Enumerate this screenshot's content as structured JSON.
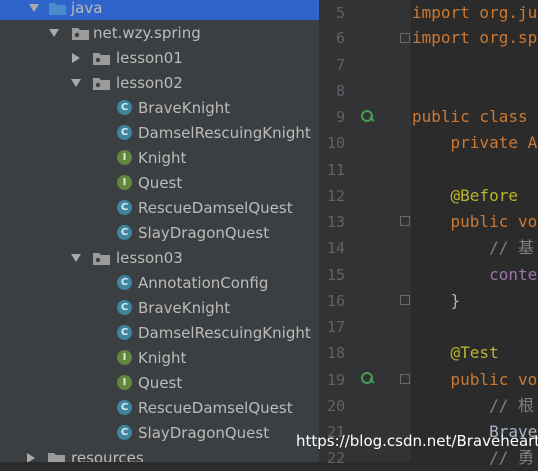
{
  "project_tree": {
    "rows": [
      {
        "label": "java",
        "kind": "folder-source",
        "expanded": true,
        "selected": true
      },
      {
        "label": "net.wzy.spring",
        "kind": "package",
        "expanded": true
      },
      {
        "label": "lesson01",
        "kind": "package",
        "expanded": false
      },
      {
        "label": "lesson02",
        "kind": "package",
        "expanded": true
      },
      {
        "label": "BraveKnight",
        "kind": "class"
      },
      {
        "label": "DamselRescuingKnight",
        "kind": "class"
      },
      {
        "label": "Knight",
        "kind": "interface"
      },
      {
        "label": "Quest",
        "kind": "interface"
      },
      {
        "label": "RescueDamselQuest",
        "kind": "class"
      },
      {
        "label": "SlayDragonQuest",
        "kind": "class"
      },
      {
        "label": "lesson03",
        "kind": "package",
        "expanded": true
      },
      {
        "label": "AnnotationConfig",
        "kind": "class"
      },
      {
        "label": "BraveKnight",
        "kind": "class"
      },
      {
        "label": "DamselRescuingKnight",
        "kind": "class"
      },
      {
        "label": "Knight",
        "kind": "interface"
      },
      {
        "label": "Quest",
        "kind": "interface"
      },
      {
        "label": "RescueDamselQuest",
        "kind": "class"
      },
      {
        "label": "SlayDragonQuest",
        "kind": "class"
      },
      {
        "label": "resources",
        "kind": "folder",
        "expanded": false
      }
    ],
    "class_glyph": "C",
    "interface_glyph": "I"
  },
  "editor": {
    "lines": [
      {
        "num": "5",
        "text": "import org.ju"
      },
      {
        "num": "6",
        "text": "import org.sp"
      },
      {
        "num": "7",
        "text": ""
      },
      {
        "num": "8",
        "text": ""
      },
      {
        "num": "9",
        "text": "public class "
      },
      {
        "num": "10",
        "text": "    private A"
      },
      {
        "num": "11",
        "text": ""
      },
      {
        "num": "12",
        "text": "    @Before"
      },
      {
        "num": "13",
        "text": "    public vo"
      },
      {
        "num": "14",
        "text": "        // 基"
      },
      {
        "num": "15",
        "text": "        conte"
      },
      {
        "num": "16",
        "text": "    }"
      },
      {
        "num": "17",
        "text": ""
      },
      {
        "num": "18",
        "text": "    @Test"
      },
      {
        "num": "19",
        "text": "    public vo"
      },
      {
        "num": "20",
        "text": "        // 根"
      },
      {
        "num": "21",
        "text": "        Brave"
      },
      {
        "num": "22",
        "text": "        // 勇"
      }
    ]
  },
  "watermark": "https://blog.csdn.net/Braveheart",
  "colors": {
    "tree_bg": "#3c3f41",
    "editor_bg": "#2b2b2b",
    "gutter_bg": "#313335",
    "selection": "#2f65ca",
    "keyword": "#cc7832",
    "annotation": "#bbb529",
    "class_icon": "#3e86a0",
    "interface_icon": "#62863c"
  },
  "icons": {
    "folder": "folder-icon",
    "package": "package-icon",
    "class": "class-icon",
    "interface": "interface-icon",
    "run_gutter": "run-test-icon"
  }
}
